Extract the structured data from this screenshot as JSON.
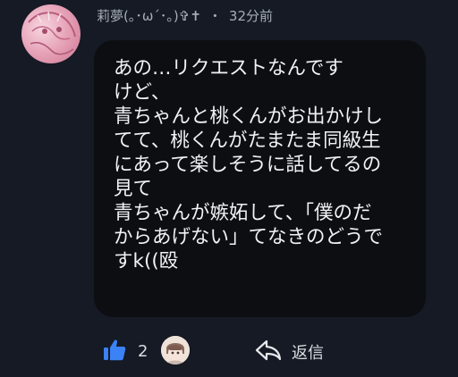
{
  "comment": {
    "username": "莉夢(｡･ω´･｡)✞✝",
    "separator": "・",
    "time": "32分前",
    "lines": [
      "あの…リクエストなんです",
      "けど、",
      "青ちゃんと桃くんがお出かけし",
      "てて、桃くんがたまたま同級生",
      "にあって楽しそうに話してるの",
      "見て",
      "青ちゃんが嫉妬して、「僕のだ",
      "からあげない」てなきのどうで",
      "すk((殴"
    ]
  },
  "actions": {
    "like_count": "2",
    "reply_label": "返信"
  },
  "colors": {
    "background": "#151a24",
    "bubble": "#0c0e12",
    "like_accent": "#3b82f6"
  }
}
